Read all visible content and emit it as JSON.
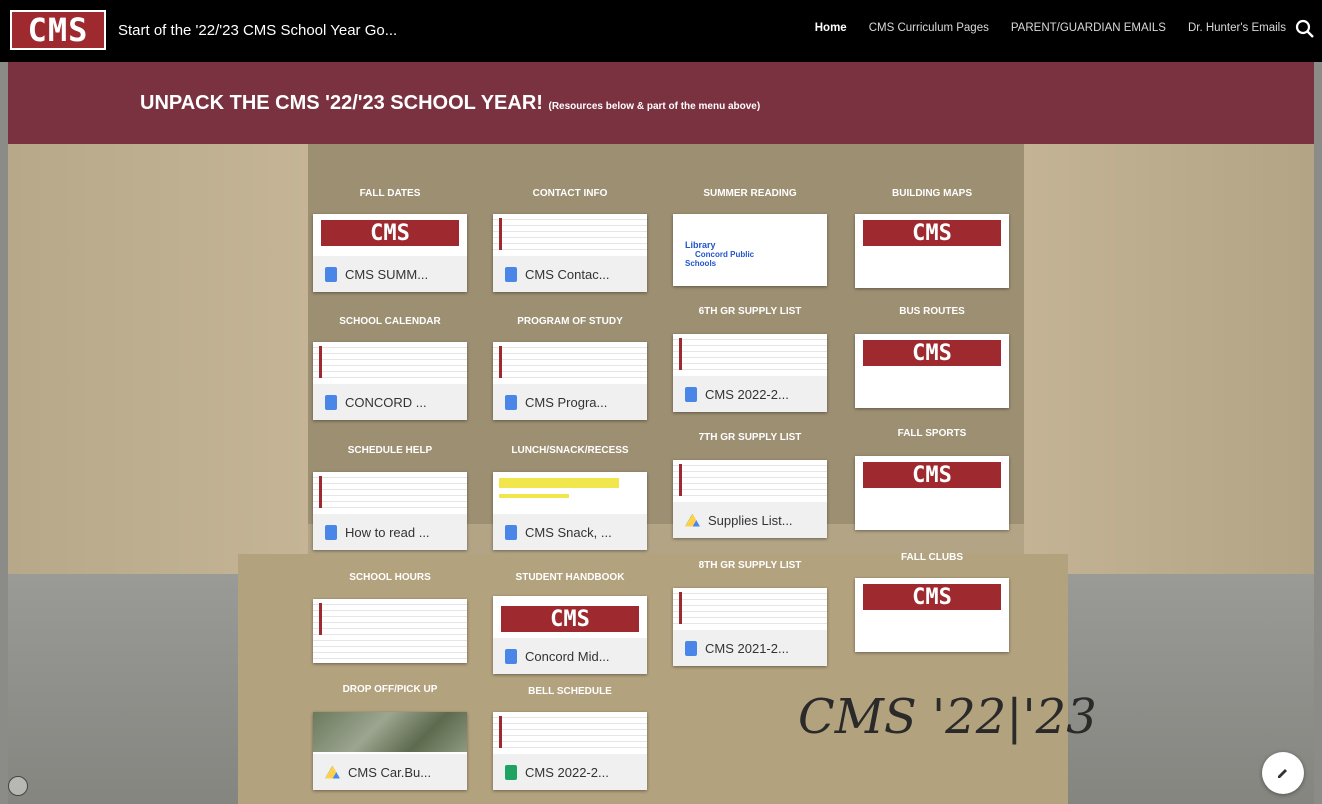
{
  "header": {
    "logo_text": "CMS",
    "site_title": "Start of the '22/'23 CMS School Year Go...",
    "nav": [
      {
        "label": "Home",
        "active": true
      },
      {
        "label": "CMS Curriculum Pages",
        "active": false
      },
      {
        "label": "PARENT/GUARDIAN EMAILS",
        "active": false
      },
      {
        "label": "Dr. Hunter's Emails",
        "active": false
      }
    ]
  },
  "banner": {
    "title": "UNPACK THE  CMS '22/'23 SCHOOL YEAR!",
    "subtitle": "(Resources below & part of the menu above)"
  },
  "columns": [
    [
      {
        "label": "FALL DATES",
        "file": "CMS SUMM...",
        "thumb": "logo",
        "icon": "doc"
      },
      {
        "label": "SCHOOL CALENDAR",
        "file": "CONCORD ...",
        "thumb": "doc",
        "icon": "doc"
      },
      {
        "label": "SCHEDULE HELP",
        "file": "How to read ...",
        "thumb": "doc",
        "icon": "doc"
      },
      {
        "label": "SCHOOL HOURS",
        "file": "",
        "thumb": "doc",
        "icon": "none"
      },
      {
        "label": "DROP OFF/PICK UP",
        "file": "CMS Car.Bu...",
        "thumb": "map",
        "icon": "drive"
      }
    ],
    [
      {
        "label": "CONTACT INFO",
        "file": "CMS Contac...",
        "thumb": "doc",
        "icon": "doc"
      },
      {
        "label": "PROGRAM OF STUDY",
        "file": "CMS Progra...",
        "thumb": "doc",
        "icon": "doc"
      },
      {
        "label": "LUNCH/SNACK/RECESS",
        "file": "CMS Snack, ...",
        "thumb": "yellow",
        "icon": "doc"
      },
      {
        "label": "STUDENT HANDBOOK",
        "file": "Concord Mid...",
        "thumb": "logo",
        "icon": "doc"
      },
      {
        "label": "BELL SCHEDULE",
        "file": "CMS 2022-2...",
        "thumb": "doc",
        "icon": "sheet"
      }
    ],
    [
      {
        "label": "SUMMER READING",
        "file": "",
        "thumb": "doc",
        "icon": "none"
      },
      {
        "label": "6TH GR SUPPLY LIST",
        "file": "CMS 2022-2...",
        "thumb": "doc",
        "icon": "doc"
      },
      {
        "label": "7TH GR SUPPLY LIST",
        "file": "Supplies List...",
        "thumb": "doc",
        "icon": "drive"
      },
      {
        "label": "8TH GR SUPPLY LIST",
        "file": "CMS 2021-2...",
        "thumb": "doc",
        "icon": "doc"
      }
    ],
    [
      {
        "label": "BUILDING MAPS",
        "file": "",
        "thumb": "logo",
        "icon": "none"
      },
      {
        "label": "BUS ROUTES",
        "file": "",
        "thumb": "logo",
        "icon": "none"
      },
      {
        "label": "FALL SPORTS",
        "file": "",
        "thumb": "logo",
        "icon": "none"
      },
      {
        "label": "FALL CLUBS",
        "file": "",
        "thumb": "logo",
        "icon": "none"
      }
    ]
  ],
  "summer_reading_thumb": {
    "line1": "Library",
    "line2": "Concord Public",
    "line3": "Schools"
  },
  "signature": "CMS '22|'23",
  "colors": {
    "brand": "#9e2a2f",
    "banner": "#7b3240",
    "topbar": "#000000"
  }
}
